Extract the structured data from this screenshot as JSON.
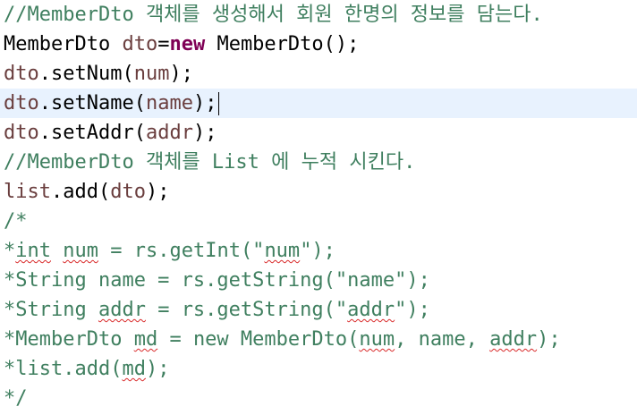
{
  "lines": {
    "l1": {
      "comment": "//MemberDto 객체를 생성해서 회원 한명의 정보를 담는다."
    },
    "l2": {
      "t1": "MemberDto ",
      "t2": "dto",
      "t3": "=",
      "t4": "new",
      "t5": " MemberDto();"
    },
    "l3": {
      "t1": "dto",
      "t2": ".setNum(",
      "t3": "num",
      "t4": ");"
    },
    "l4": {
      "t1": "dto",
      "t2": ".setName(",
      "t3": "name",
      "t4": ");"
    },
    "l5": {
      "t1": "dto",
      "t2": ".setAddr(",
      "t3": "addr",
      "t4": ");"
    },
    "l6": {
      "comment": "//MemberDto 객체를 List 에 누적 시킨다."
    },
    "l7": {
      "t1": "list",
      "t2": ".add(",
      "t3": "dto",
      "t4": ");"
    },
    "l8": {
      "comment": "/*"
    },
    "l9": {
      "a": "*",
      "b": "int",
      "c": " ",
      "d": "num",
      "e": " = rs.getInt(\"",
      "f": "num",
      "g": "\");"
    },
    "l10": {
      "a": "*String name = rs.getString(\"name\");"
    },
    "l11": {
      "a": "*String ",
      "b": "addr",
      "c": " = rs.getString(\"",
      "d": "addr",
      "e": "\");"
    },
    "l12": {
      "a": "*MemberDto ",
      "b": "md",
      "c": " = new MemberDto(",
      "d": "num",
      "e": ", name, ",
      "f": "addr",
      "g": ");"
    },
    "l13": {
      "a": "*list.add(",
      "b": "md",
      "c": ");"
    },
    "l14": {
      "comment": "*/"
    }
  }
}
